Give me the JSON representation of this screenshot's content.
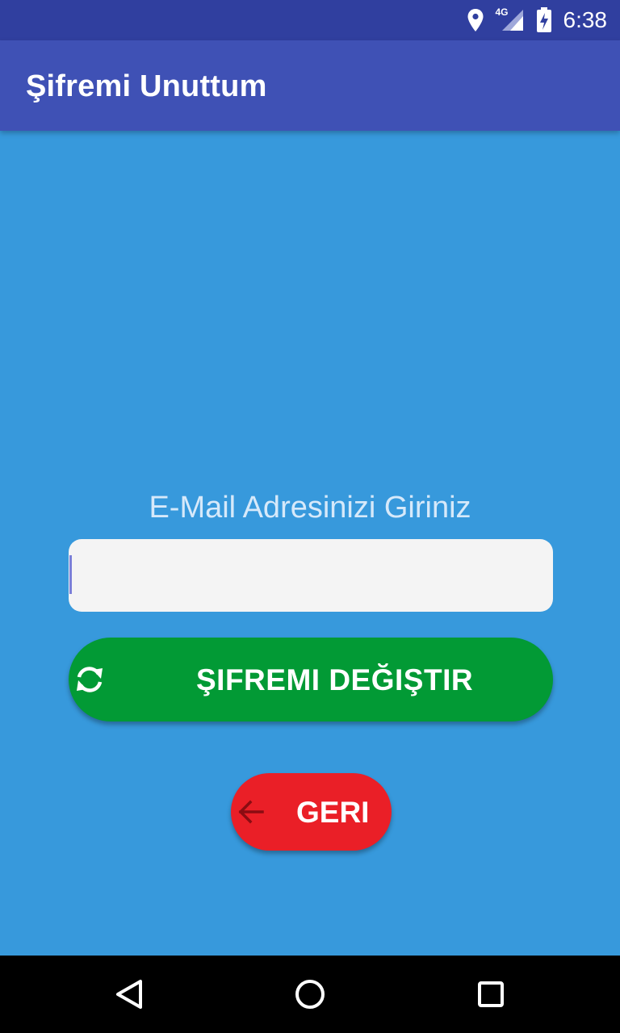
{
  "status_bar": {
    "time": "6:38",
    "network": "4G",
    "icons": [
      "location-icon",
      "signal-4g-icon",
      "battery-charging-icon"
    ]
  },
  "app_bar": {
    "title": "Şifremi Unuttum"
  },
  "form": {
    "prompt": "E-Mail Adresinizi Giriniz",
    "email_value": "",
    "change_password_label": "ŞIFREMI DEĞIŞTIR",
    "change_password_icon": "refresh-icon",
    "back_label": "GERI",
    "back_icon": "arrow-left-icon"
  },
  "nav_bar": {
    "icons": [
      "back-triangle-icon",
      "home-circle-icon",
      "recents-square-icon"
    ]
  },
  "colors": {
    "status_bar": "#303f9f",
    "app_bar": "#3f51b5",
    "background": "#3799dc",
    "field": "#f4f4f4",
    "change_button": "#029a35",
    "back_button": "#ea1f27",
    "nav_bar": "#000000"
  }
}
